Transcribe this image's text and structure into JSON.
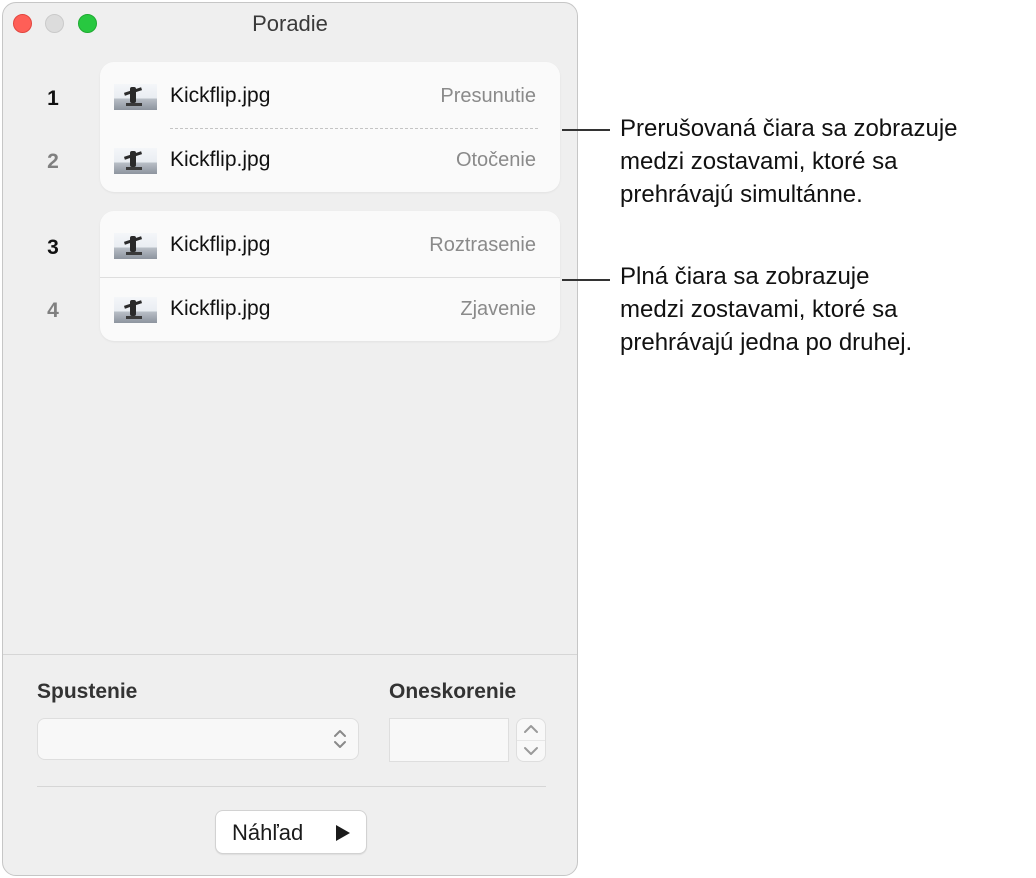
{
  "window": {
    "title": "Poradie"
  },
  "build_order": [
    {
      "number": "1",
      "file": "Kickflip.jpg",
      "animation": "Presunutie"
    },
    {
      "number": "2",
      "file": "Kickflip.jpg",
      "animation": "Otočenie"
    },
    {
      "number": "3",
      "file": "Kickflip.jpg",
      "animation": "Roztrasenie"
    },
    {
      "number": "4",
      "file": "Kickflip.jpg",
      "animation": "Zjavenie"
    }
  ],
  "controls": {
    "start_label": "Spustenie",
    "start_value": "",
    "delay_label": "Oneskorenie",
    "delay_value": "",
    "preview_label": "Náhľad"
  },
  "callouts": {
    "dashed_line": [
      "Prerušovaná čiara sa zobrazuje",
      "medzi zostavami, ktoré sa",
      "prehrávajú simultánne."
    ],
    "solid_line": [
      "Plná čiara sa zobrazuje",
      "medzi zostavami, ktoré sa",
      "prehrávajú jedna po druhej."
    ]
  },
  "colors": {
    "close": "#fe5f57",
    "minimize": "#dcdcdc",
    "maximize": "#28c840"
  }
}
